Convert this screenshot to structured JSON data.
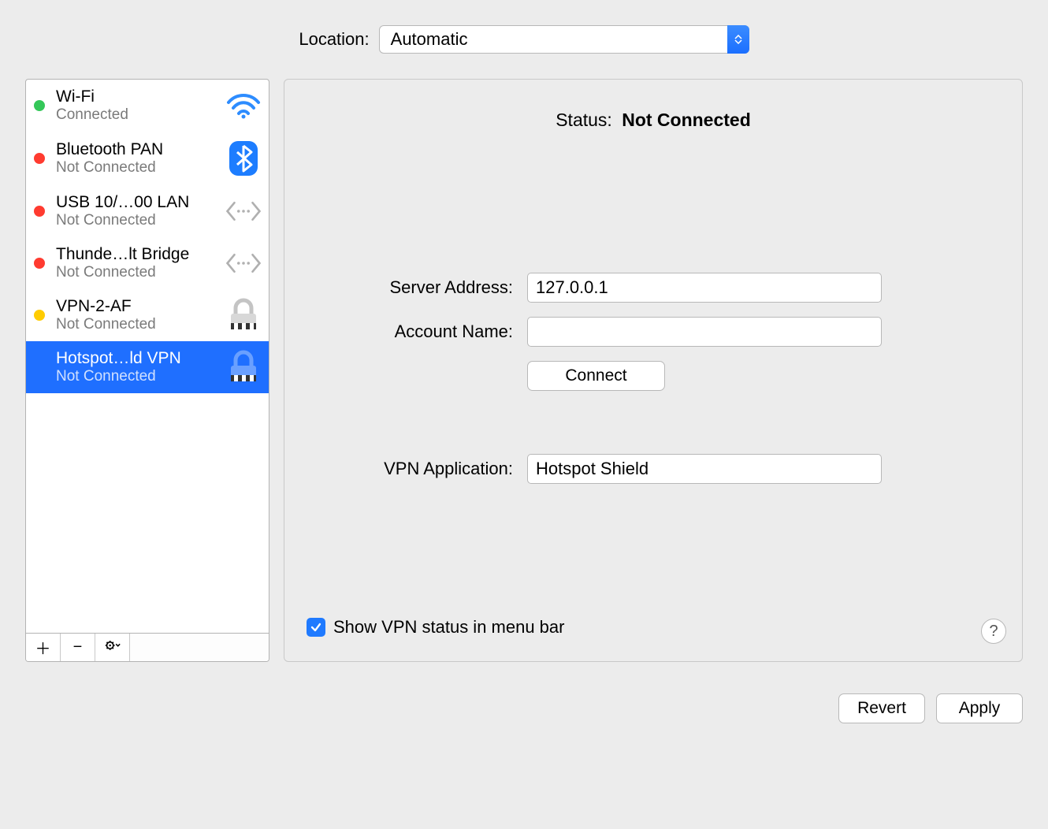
{
  "location": {
    "label": "Location:",
    "value": "Automatic"
  },
  "services": [
    {
      "name": "Wi-Fi",
      "status": "Connected",
      "dot": "green",
      "icon": "wifi",
      "selected": false
    },
    {
      "name": "Bluetooth PAN",
      "status": "Not Connected",
      "dot": "red",
      "icon": "bluetooth",
      "selected": false
    },
    {
      "name": "USB 10/…00 LAN",
      "status": "Not Connected",
      "dot": "red",
      "icon": "ethernet",
      "selected": false
    },
    {
      "name": "Thunde…lt Bridge",
      "status": "Not Connected",
      "dot": "red",
      "icon": "ethernet",
      "selected": false
    },
    {
      "name": "VPN-2-AF",
      "status": "Not Connected",
      "dot": "yellow",
      "icon": "lock",
      "selected": false
    },
    {
      "name": "Hotspot…ld VPN",
      "status": "Not Connected",
      "dot": "",
      "icon": "lock-sel",
      "selected": true
    }
  ],
  "detail": {
    "status_label": "Status:",
    "status_value": "Not Connected",
    "server_address_label": "Server Address:",
    "server_address_value": "127.0.0.1",
    "account_name_label": "Account Name:",
    "account_name_value": "",
    "connect_label": "Connect",
    "vpn_app_label": "VPN Application:",
    "vpn_app_value": "Hotspot Shield",
    "show_menu_label": "Show VPN status in menu bar",
    "show_menu_checked": true
  },
  "footer": {
    "revert": "Revert",
    "apply": "Apply"
  },
  "help_label": "?"
}
